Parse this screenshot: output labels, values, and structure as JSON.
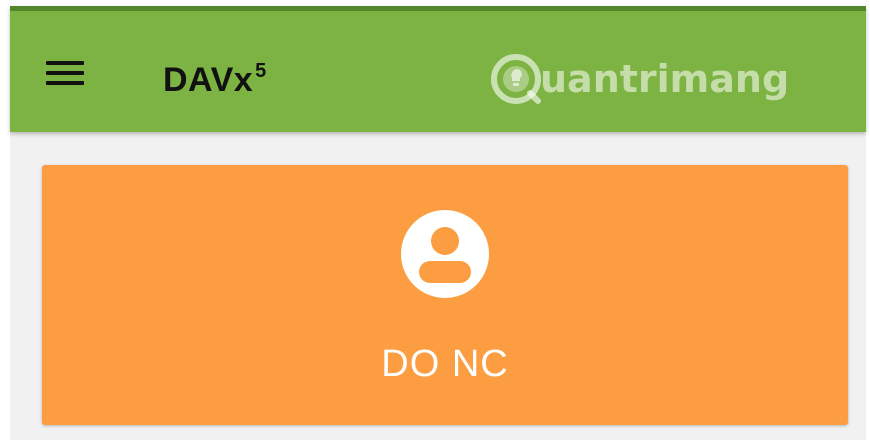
{
  "toolbar": {
    "app_name": "DAVx",
    "app_name_superscript": "5",
    "menu_icon": "hamburger-menu-icon",
    "color": "#7cb342"
  },
  "watermark": {
    "text": "uantrimang",
    "logo_icon": "quantrimang-logo-icon"
  },
  "account": {
    "name": "DO NC",
    "icon": "account-circle-icon",
    "card_color": "#fb9d40"
  }
}
